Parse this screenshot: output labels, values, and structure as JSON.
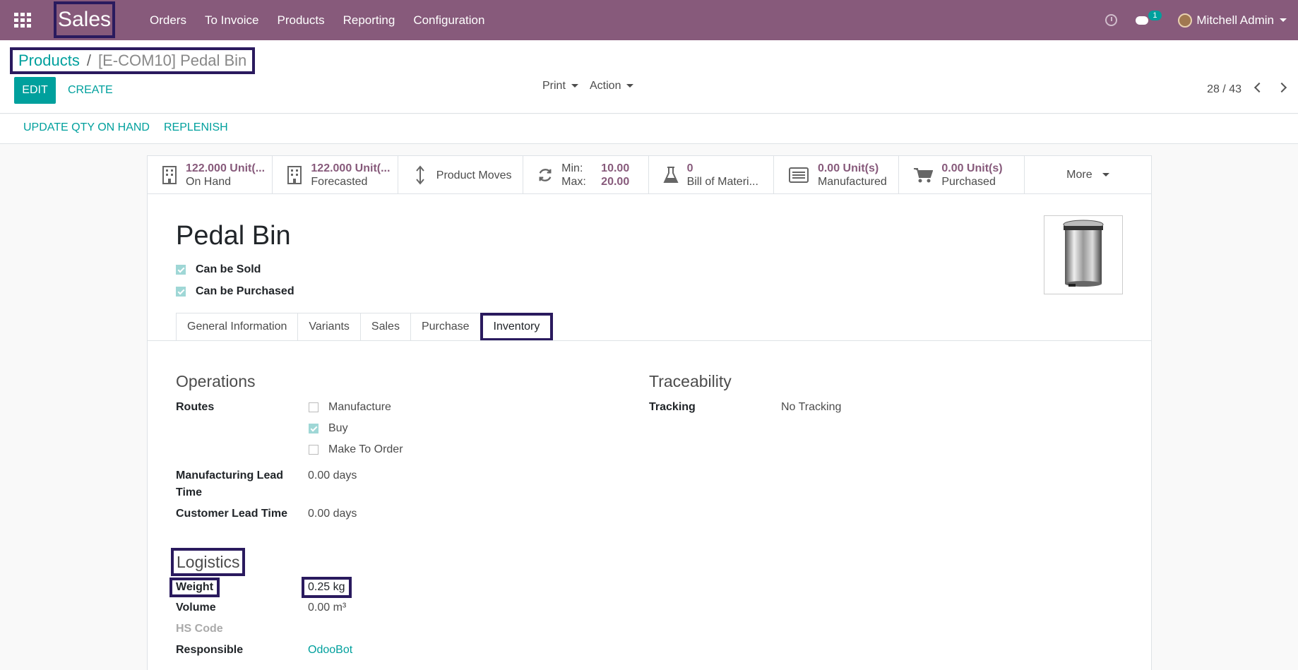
{
  "navbar": {
    "brand": "Sales",
    "menu": [
      "Orders",
      "To Invoice",
      "Products",
      "Reporting",
      "Configuration"
    ],
    "chat_count": "1",
    "user": "Mitchell Admin"
  },
  "breadcrumb": {
    "parent": "Products",
    "current": "[E-COM10] Pedal Bin"
  },
  "control": {
    "edit": "EDIT",
    "create": "CREATE",
    "print": "Print",
    "action": "Action",
    "pager": "28 / 43"
  },
  "status": {
    "update_qty": "UPDATE QTY ON HAND",
    "replenish": "REPLENISH"
  },
  "stats": {
    "on_hand": {
      "value": "122.000 Unit(...",
      "label": "On Hand"
    },
    "forecasted": {
      "value": "122.000 Unit(...",
      "label": "Forecasted"
    },
    "moves": {
      "label": "Product Moves"
    },
    "minmax": {
      "min_label": "Min:",
      "min": "10.00",
      "max_label": "Max:",
      "max": "20.00"
    },
    "bom": {
      "value": "0",
      "label": "Bill of Materi..."
    },
    "manufactured": {
      "value": "0.00 Unit(s)",
      "label": "Manufactured"
    },
    "purchased": {
      "value": "0.00 Unit(s)",
      "label": "Purchased"
    },
    "more": "More"
  },
  "product": {
    "name": "Pedal Bin",
    "can_be_sold": "Can be Sold",
    "can_be_purchased": "Can be Purchased"
  },
  "tabs": [
    "General Information",
    "Variants",
    "Sales",
    "Purchase",
    "Inventory"
  ],
  "operations": {
    "title": "Operations",
    "routes_label": "Routes",
    "routes": [
      "Manufacture",
      "Buy",
      "Make To Order"
    ],
    "mfg_lead_label_1": "Manufacturing Lead",
    "mfg_lead_label_2": "Time",
    "mfg_lead_value": "0.00 days",
    "cust_lead_label": "Customer Lead Time",
    "cust_lead_value": "0.00 days"
  },
  "traceability": {
    "title": "Traceability",
    "tracking_label": "Tracking",
    "tracking_value": "No Tracking"
  },
  "logistics": {
    "title": "Logistics",
    "weight_label": "Weight",
    "weight_value": "0.25",
    "weight_unit": "kg",
    "volume_label": "Volume",
    "volume_value": "0.00",
    "volume_unit": "m³",
    "hs_label": "HS Code",
    "responsible_label": "Responsible",
    "responsible_value": "OdooBot"
  }
}
